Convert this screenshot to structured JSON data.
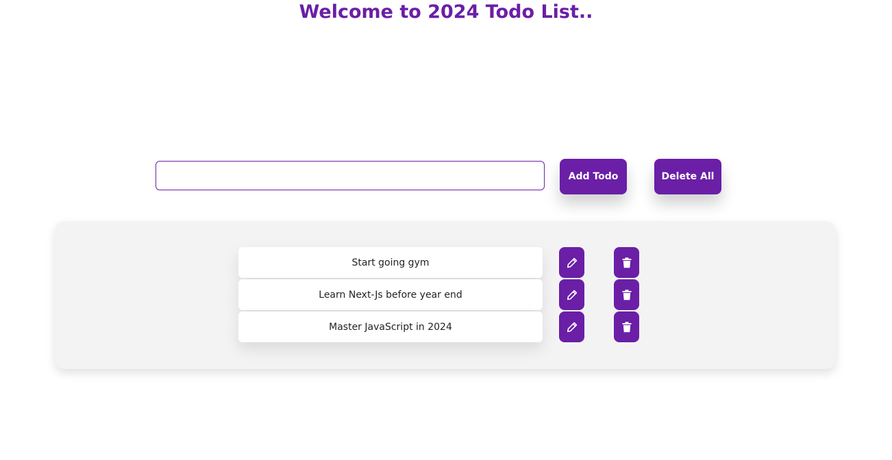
{
  "header": {
    "title": "Welcome to 2024 Todo List.."
  },
  "form": {
    "input_value": "",
    "input_placeholder": "",
    "add_button_label": "Add Todo",
    "delete_all_button_label": "Delete All"
  },
  "todos": [
    {
      "text": "Start going gym"
    },
    {
      "text": "Learn Next-Js before year end"
    },
    {
      "text": "Master JavaScript in 2024"
    }
  ],
  "icons": {
    "edit": "pencil-icon",
    "delete": "trash-icon"
  },
  "colors": {
    "accent": "#6a1fa6",
    "panel_bg": "#f3f3f3",
    "item_bg": "#ffffff",
    "text": "#222222"
  }
}
